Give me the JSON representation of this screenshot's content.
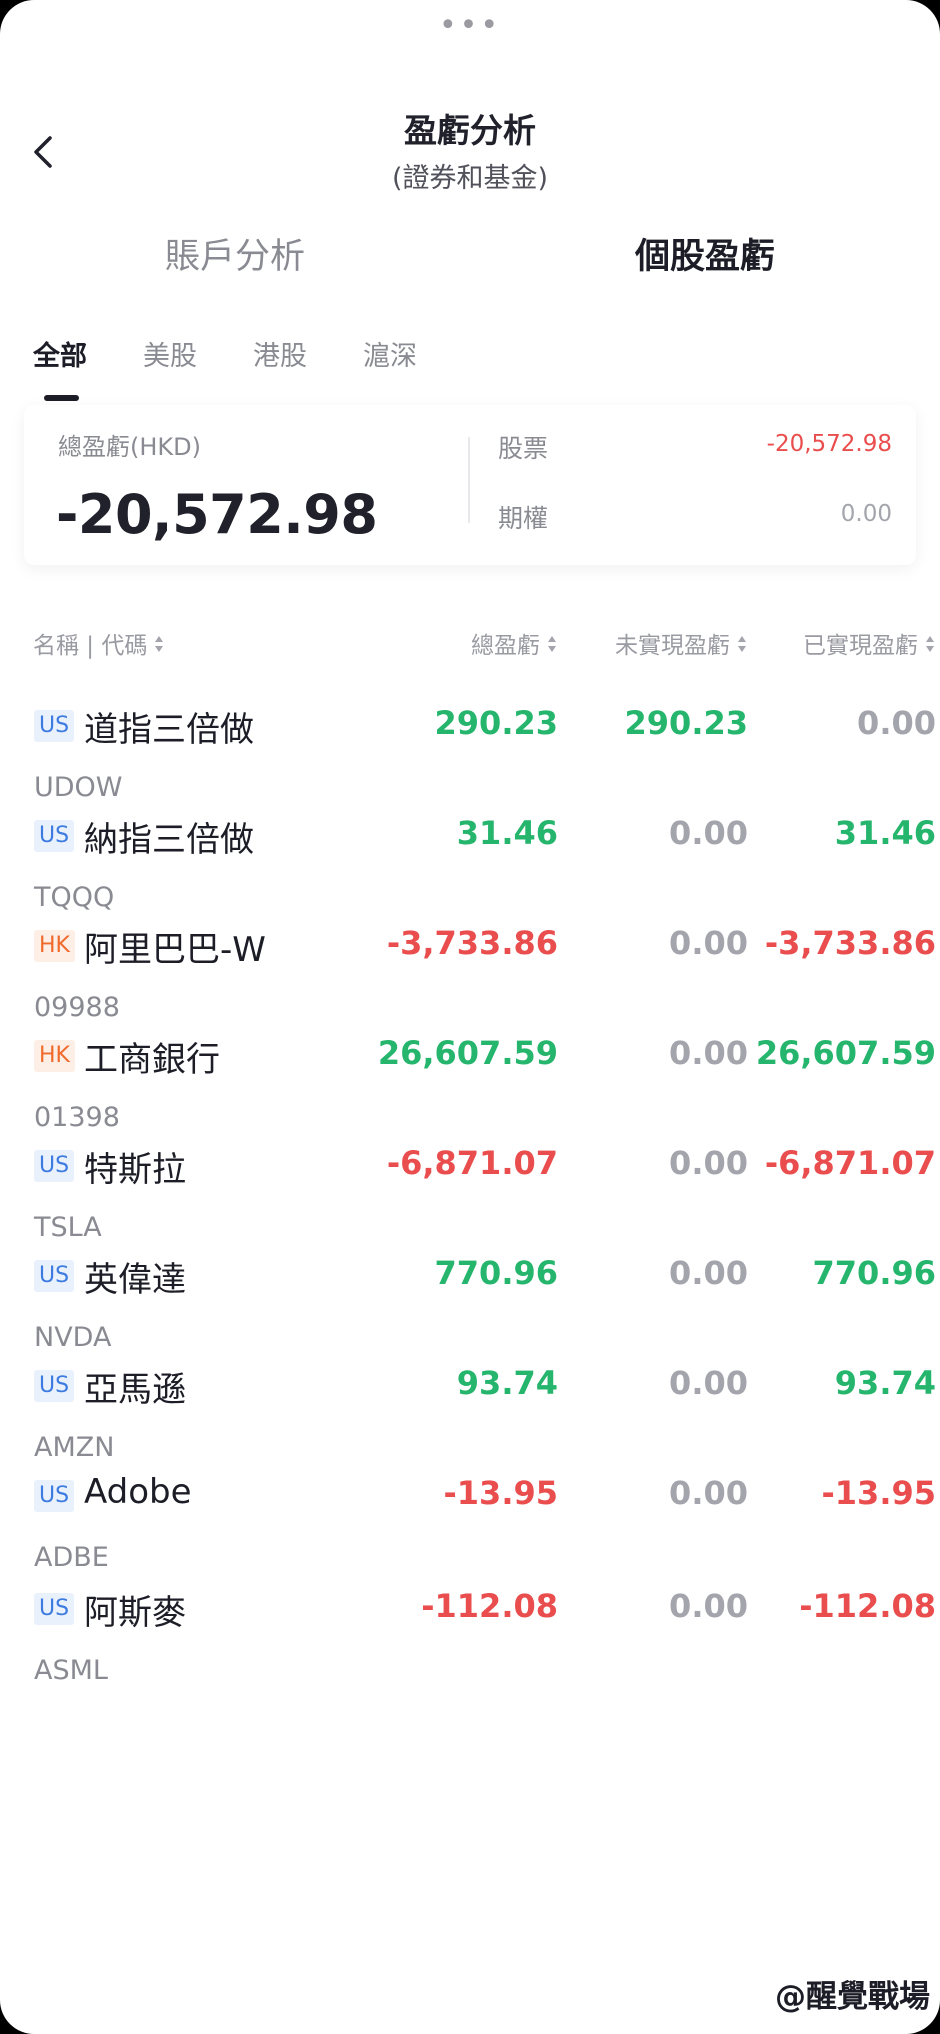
{
  "header": {
    "title": "盈虧分析",
    "subtitle": "(證券和基金)",
    "top_tabs": [
      "賬戶分析",
      "個股盈虧"
    ]
  },
  "market_tabs": [
    "全部",
    "美股",
    "港股",
    "滬深"
  ],
  "summary": {
    "total_label": "總盈虧(HKD)",
    "total_value": "-20,572.98",
    "breakdown": [
      {
        "label": "股票",
        "value": "-20,572.98"
      },
      {
        "label": "期權",
        "value": "0.00"
      }
    ]
  },
  "table": {
    "headers": [
      "名稱 | 代碼",
      "總盈虧",
      "未實現盈虧",
      "已實現盈虧"
    ],
    "rows": [
      {
        "market": "US",
        "name": "道指三倍做",
        "code": "UDOW",
        "total": "290.23",
        "unrealized": "290.23",
        "realized": "0.00"
      },
      {
        "market": "US",
        "name": "納指三倍做",
        "code": "TQQQ",
        "total": "31.46",
        "unrealized": "0.00",
        "realized": "31.46"
      },
      {
        "market": "HK",
        "name": "阿里巴巴-W",
        "code": "09988",
        "total": "-3,733.86",
        "unrealized": "0.00",
        "realized": "-3,733.86"
      },
      {
        "market": "HK",
        "name": "工商銀行",
        "code": "01398",
        "total": "26,607.59",
        "unrealized": "0.00",
        "realized": "26,607.59"
      },
      {
        "market": "US",
        "name": "特斯拉",
        "code": "TSLA",
        "total": "-6,871.07",
        "unrealized": "0.00",
        "realized": "-6,871.07"
      },
      {
        "market": "US",
        "name": "英偉達",
        "code": "NVDA",
        "total": "770.96",
        "unrealized": "0.00",
        "realized": "770.96"
      },
      {
        "market": "US",
        "name": "亞馬遜",
        "code": "AMZN",
        "total": "93.74",
        "unrealized": "0.00",
        "realized": "93.74"
      },
      {
        "market": "US",
        "name": "Adobe",
        "code": "ADBE",
        "total": "-13.95",
        "unrealized": "0.00",
        "realized": "-13.95"
      },
      {
        "market": "US",
        "name": "阿斯麥",
        "code": "ASML",
        "total": "-112.08",
        "unrealized": "0.00",
        "realized": "-112.08"
      }
    ]
  },
  "watermark": "@醒覺戰場",
  "colors": {
    "gain": "#25b56c",
    "loss": "#ea4d4d",
    "neutral": "#a4a5ac",
    "us_badge": "#3d7be0",
    "hk_badge": "#f06a2c"
  }
}
